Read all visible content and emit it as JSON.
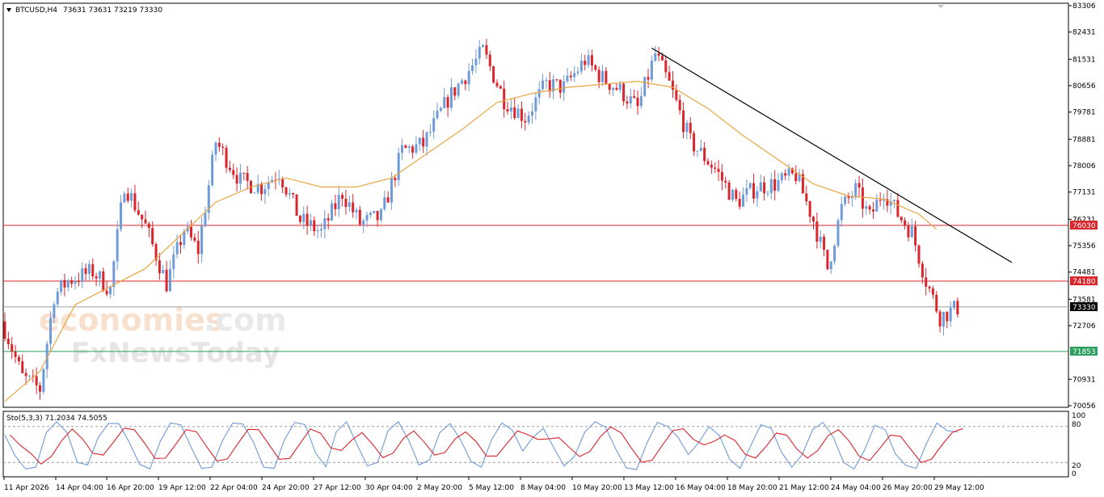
{
  "header": {
    "symbol": "BTCUSD,H4",
    "ohlc": "73631 73631 73219 73330"
  },
  "watermark": {
    "line1_a": "economies",
    "line1_b": ".com",
    "line2": "FxNewsToday"
  },
  "indicator": {
    "name": "Sto(5,3,3) 71.2034 74.5055",
    "levels": [
      "100",
      "80",
      "20",
      "0"
    ]
  },
  "price_axis": {
    "ticks": [
      "83306",
      "82431",
      "81531",
      "80656",
      "79781",
      "78881",
      "78006",
      "77131",
      "76231",
      "75356",
      "74481",
      "73581",
      "72706",
      "70931",
      "70056"
    ],
    "resistance_1": "76030",
    "resistance_2": "74180",
    "current": "73330",
    "support": "71853"
  },
  "time_axis": [
    "11 Apr 2026",
    "14 Apr 04:00",
    "16 Apr 20:00",
    "19 Apr 12:00",
    "22 Apr 04:00",
    "24 Apr 20:00",
    "27 Apr 12:00",
    "30 Apr 04:00",
    "2 May 20:00",
    "5 May 12:00",
    "8 May 04:00",
    "10 May 20:00",
    "13 May 12:00",
    "16 May 04:00",
    "18 May 20:00",
    "21 May 12:00",
    "24 May 04:00",
    "26 May 20:00",
    "29 May 12:00"
  ],
  "colors": {
    "bull": "#6f9bd8",
    "bear": "#d9262c",
    "ma": "#e8a640",
    "level": "#d9262c",
    "support": "#2e9e5e",
    "stoch_k": "#6f9bd8",
    "stoch_d": "#d9262c"
  },
  "chart_data": {
    "type": "candlestick",
    "symbol": "BTCUSD",
    "timeframe": "H4",
    "ylim": [
      70056,
      83306
    ],
    "x_labels": [
      "11 Apr 2026",
      "14 Apr 04:00",
      "16 Apr 20:00",
      "19 Apr 12:00",
      "22 Apr 04:00",
      "24 Apr 20:00",
      "27 Apr 12:00",
      "30 Apr 04:00",
      "2 May 20:00",
      "5 May 12:00",
      "8 May 04:00",
      "10 May 20:00",
      "13 May 12:00",
      "16 May 04:00",
      "18 May 20:00",
      "21 May 12:00",
      "24 May 04:00",
      "26 May 20:00",
      "29 May 12:00"
    ],
    "close_path": [
      [
        0,
        72600
      ],
      [
        5,
        71000
      ],
      [
        10,
        70600
      ],
      [
        14,
        73700
      ],
      [
        18,
        74200
      ],
      [
        25,
        74500
      ],
      [
        30,
        73900
      ],
      [
        34,
        77400
      ],
      [
        40,
        76000
      ],
      [
        46,
        74100
      ],
      [
        51,
        75900
      ],
      [
        55,
        75200
      ],
      [
        60,
        78800
      ],
      [
        67,
        77500
      ],
      [
        73,
        77300
      ],
      [
        78,
        77800
      ],
      [
        84,
        76200
      ],
      [
        90,
        75800
      ],
      [
        96,
        77100
      ],
      [
        101,
        76100
      ],
      [
        107,
        76300
      ],
      [
        113,
        78500
      ],
      [
        119,
        78700
      ],
      [
        126,
        80200
      ],
      [
        131,
        81000
      ],
      [
        136,
        81800
      ],
      [
        142,
        80200
      ],
      [
        148,
        79600
      ],
      [
        154,
        80700
      ],
      [
        159,
        80600
      ],
      [
        165,
        81500
      ],
      [
        170,
        80900
      ],
      [
        175,
        80500
      ],
      [
        180,
        79900
      ],
      [
        185,
        81700
      ],
      [
        189,
        80700
      ],
      [
        195,
        78800
      ],
      [
        202,
        77900
      ],
      [
        208,
        76800
      ],
      [
        214,
        77300
      ],
      [
        219,
        77400
      ],
      [
        225,
        77700
      ],
      [
        230,
        76200
      ],
      [
        234,
        74600
      ],
      [
        238,
        76600
      ],
      [
        242,
        77200
      ],
      [
        246,
        76300
      ],
      [
        250,
        77200
      ],
      [
        254,
        76400
      ],
      [
        258,
        75800
      ],
      [
        262,
        74200
      ],
      [
        266,
        73000
      ],
      [
        271,
        73300
      ]
    ],
    "ma_path": [
      [
        0,
        70200
      ],
      [
        10,
        71200
      ],
      [
        20,
        73400
      ],
      [
        30,
        74000
      ],
      [
        40,
        74600
      ],
      [
        50,
        75700
      ],
      [
        60,
        76800
      ],
      [
        70,
        77300
      ],
      [
        80,
        77600
      ],
      [
        90,
        77300
      ],
      [
        100,
        77300
      ],
      [
        110,
        77600
      ],
      [
        120,
        78400
      ],
      [
        130,
        79200
      ],
      [
        140,
        80100
      ],
      [
        150,
        80400
      ],
      [
        160,
        80600
      ],
      [
        170,
        80700
      ],
      [
        180,
        80800
      ],
      [
        190,
        80600
      ],
      [
        200,
        79900
      ],
      [
        210,
        79000
      ],
      [
        220,
        78200
      ],
      [
        230,
        77400
      ],
      [
        240,
        77000
      ],
      [
        250,
        76900
      ],
      [
        260,
        76400
      ],
      [
        265,
        75900
      ]
    ],
    "trendline": {
      "from": [
        "13 May 12:00",
        81900
      ],
      "to": [
        "end",
        74800
      ]
    },
    "levels": [
      {
        "name": "resistance",
        "value": 76030
      },
      {
        "name": "resistance",
        "value": 74180
      },
      {
        "name": "current",
        "value": 73330
      },
      {
        "name": "support",
        "value": 71853
      }
    ],
    "stochastic": {
      "params": "5,3,3",
      "k_last": 71.2034,
      "d_last": 74.5055,
      "levels": [
        20,
        80
      ],
      "ylim": [
        0,
        100
      ],
      "k": [
        66,
        31,
        9,
        12,
        70,
        88,
        70,
        20,
        16,
        61,
        85,
        85,
        54,
        17,
        9,
        55,
        86,
        83,
        45,
        10,
        12,
        56,
        86,
        84,
        54,
        12,
        10,
        58,
        87,
        83,
        36,
        13,
        71,
        88,
        50,
        14,
        20,
        73,
        88,
        57,
        16,
        24,
        70,
        85,
        58,
        22,
        12,
        58,
        86,
        74,
        39,
        62,
        77,
        45,
        14,
        30,
        71,
        88,
        79,
        42,
        11,
        8,
        52,
        87,
        80,
        62,
        33,
        53,
        80,
        65,
        25,
        10,
        47,
        83,
        77,
        37,
        12,
        33,
        75,
        87,
        62,
        20,
        9,
        40,
        82,
        75,
        34,
        15,
        10,
        52,
        86,
        73,
        71
      ]
    }
  }
}
